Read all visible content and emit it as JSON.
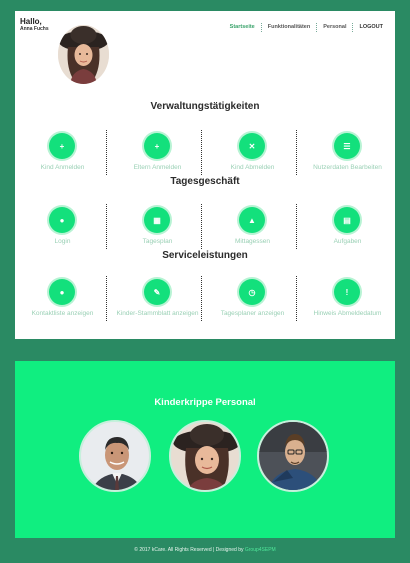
{
  "header": {
    "greeting": "Hallo,",
    "user_name": "Anna Fuchs"
  },
  "nav": {
    "items": [
      "Startseite",
      "Funktionalitäten",
      "Personal",
      "LOGOUT"
    ],
    "active": "Startseite"
  },
  "sections": [
    {
      "title": "Verwaltungstätigkeiten",
      "items": [
        {
          "label": "Kind Anmelden",
          "icon": "plus-icon"
        },
        {
          "label": "Eltern Anmelden",
          "icon": "plus-icon"
        },
        {
          "label": "Kind Abmelden",
          "icon": "cross-icon"
        },
        {
          "label": "Nutzerdaten Bearbeiten",
          "icon": "list-icon"
        }
      ]
    },
    {
      "title": "Tagesgeschäft",
      "items": [
        {
          "label": "Login",
          "icon": "user-icon"
        },
        {
          "label": "Tagesplan",
          "icon": "calendar-icon"
        },
        {
          "label": "Mittagessen",
          "icon": "bell-icon"
        },
        {
          "label": "Aufgaben",
          "icon": "tasks-icon"
        }
      ]
    },
    {
      "title": "Serviceleistungen",
      "items": [
        {
          "label": "Kontaktliste anzeigen",
          "icon": "user-icon"
        },
        {
          "label": "Kinder-Stammblatt anzeigen",
          "icon": "pencil-icon"
        },
        {
          "label": "Tagesplaner anzeigen",
          "icon": "clock-icon"
        },
        {
          "label": "Hinweis Abmeldedatum",
          "icon": "info-icon"
        }
      ]
    }
  ],
  "staff_section": {
    "title": "Kinderkrippe Personal"
  },
  "footer": {
    "text": "© 2017 kCare. All Rights Reserved | Designed by ",
    "brand": "Group4SEPM"
  },
  "colors": {
    "background": "#2a8a63",
    "accent": "#13e07c",
    "panel_green": "#10ee80",
    "active_nav": "#3aa36b"
  }
}
